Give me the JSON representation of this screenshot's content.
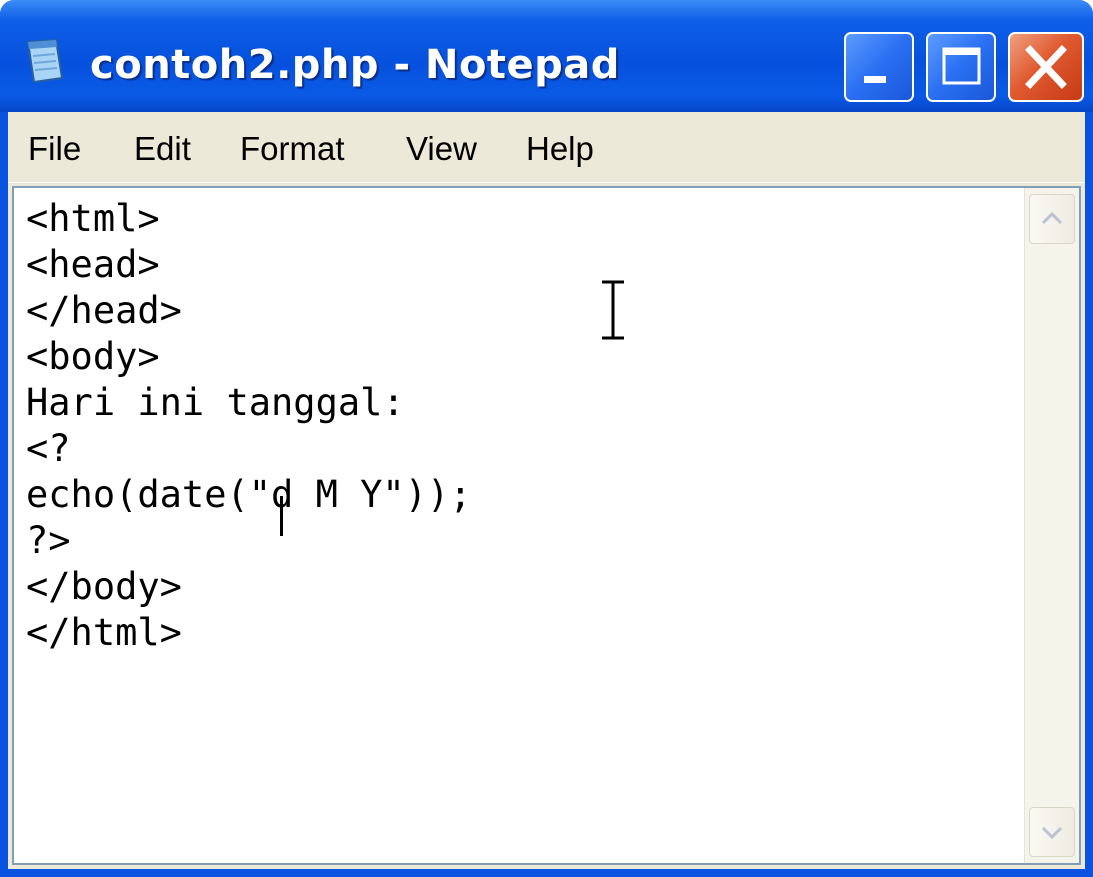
{
  "window": {
    "title": "contoh2.php - Notepad"
  },
  "menu": {
    "items": [
      "File",
      "Edit",
      "Format",
      "View",
      "Help"
    ]
  },
  "editor": {
    "content": "<html>\n<head>\n</head>\n<body>\nHari ini tanggal:\n<?\necho(date(\"d M Y\"));\n?>\n</body>\n</html>"
  },
  "icons": {
    "app": "notepad-icon",
    "minimize": "minimize-icon",
    "maximize": "maximize-icon",
    "close": "close-icon",
    "scroll_up": "scroll-up-arrow-icon",
    "scroll_down": "scroll-down-arrow-icon",
    "cursor": "i-beam-cursor-icon"
  },
  "colors": {
    "titlebar": "#0651dd",
    "chrome": "#ece9d8",
    "close_button": "#e05a30"
  }
}
